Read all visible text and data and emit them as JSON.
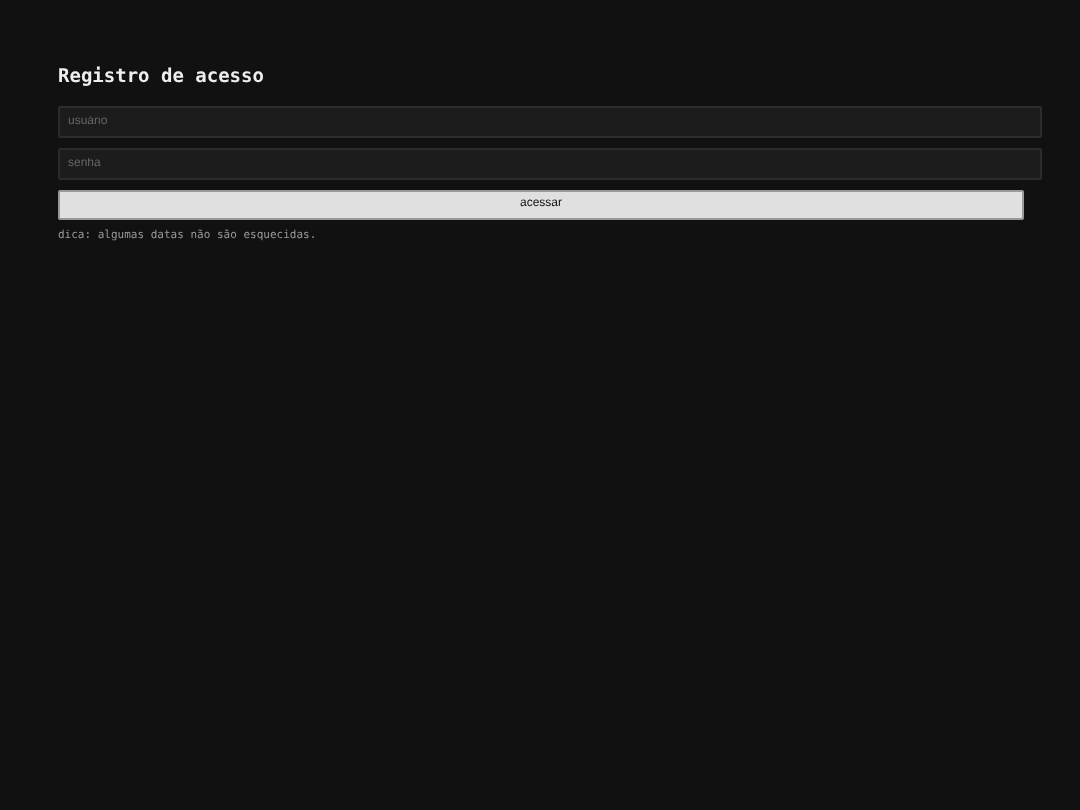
{
  "title": "Registro de acesso",
  "fields": [
    {
      "placeholder": "usuário"
    },
    {
      "placeholder": "senha"
    }
  ],
  "button": "acessar",
  "hint": "dica: algumas datas não são esquecidas."
}
